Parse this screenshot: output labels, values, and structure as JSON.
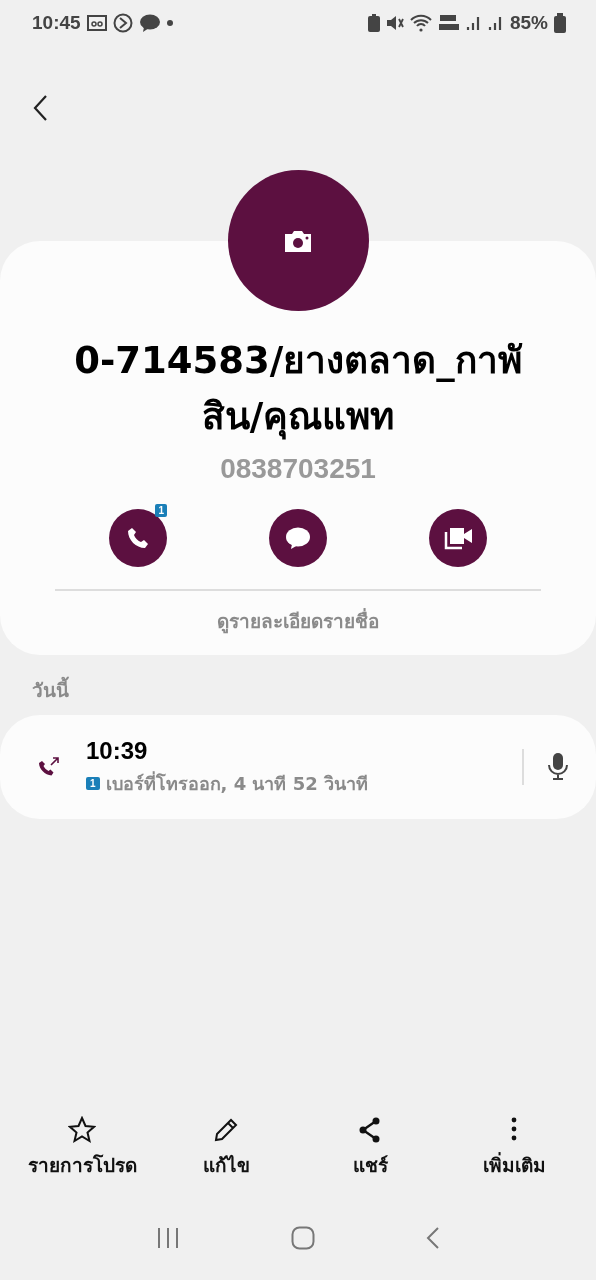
{
  "status_bar": {
    "time": "10:45",
    "battery": "85%"
  },
  "contact": {
    "name": "0-714583/ยางตลาด_กาพัสิน/คุณแพท",
    "phone": "0838703251",
    "actions": [
      {
        "kind": "call",
        "badge": "1"
      },
      {
        "kind": "message"
      },
      {
        "kind": "video"
      }
    ],
    "details_link": "ดูรายละเอียดรายชื่อ"
  },
  "section_label": "วันนี้",
  "call_log": [
    {
      "time": "10:39",
      "sim": "1",
      "description": "เบอร์ที่โทรออก, 4 นาที 52 วินาที"
    }
  ],
  "toolbar": [
    {
      "kind": "favorite",
      "label": "รายการโปรด"
    },
    {
      "kind": "edit",
      "label": "แก้ไข"
    },
    {
      "kind": "share",
      "label": "แชร์"
    },
    {
      "kind": "more",
      "label": "เพิ่มเติม"
    }
  ]
}
